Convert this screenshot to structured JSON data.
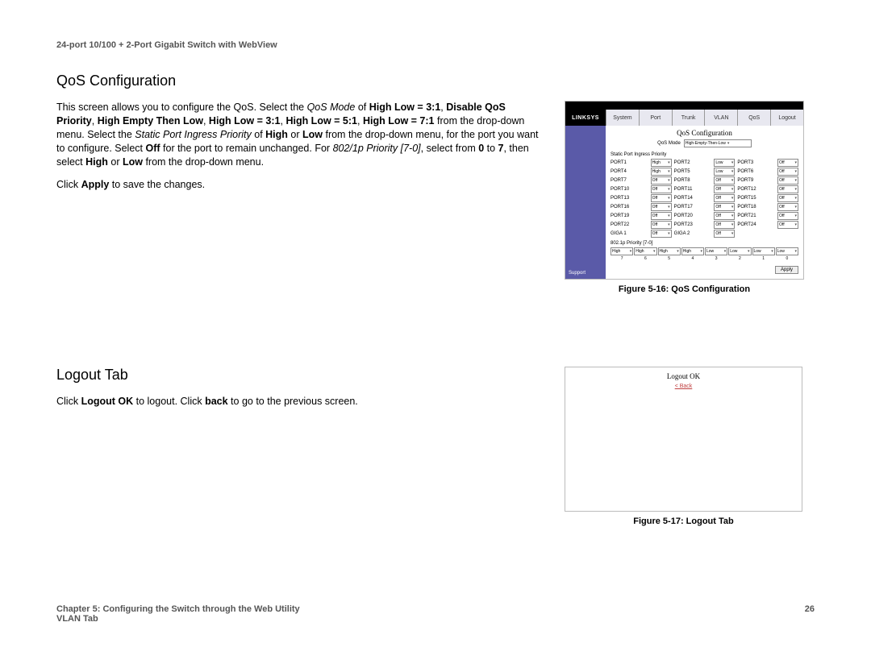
{
  "doc_header": "24-port 10/100 + 2-Port Gigabit Switch with WebView",
  "section1_title": "QoS Configuration",
  "para1_a": "This screen allows you to configure the QoS. Select the ",
  "para1_i1": "QoS Mode",
  "para1_b": " of ",
  "para1_b1": "High Low = 3:1",
  "para1_c": ", ",
  "para1_b2": "Disable QoS Priority",
  "para1_d": ", ",
  "para1_b3": "High Empty Then Low",
  "para1_e": ", ",
  "para1_b4": "High Low = 3:1",
  "para1_f": ", ",
  "para1_b5": "High Low = 5:1",
  "para1_g": ", ",
  "para1_b6": "High Low = 7:1",
  "para1_h": " from the drop-down menu. Select the ",
  "para1_i2": "Static Port Ingress Priority",
  "para1_i": " of ",
  "para1_b7": "High",
  "para1_j": " or ",
  "para1_b8": "Low",
  "para1_k": " from the drop-down menu, for the port you want to configure. Select ",
  "para1_b9": "Off",
  "para1_l": " for the port to remain unchanged. For ",
  "para1_i3": "802/1p Priority [7-0]",
  "para1_m": ", select from ",
  "para1_b10": "0",
  "para1_n": " to ",
  "para1_b11": "7",
  "para1_o": ", then select ",
  "para1_b12": "High",
  "para1_p": " or ",
  "para1_b13": "Low",
  "para1_q": " from the drop-down menu.",
  "para2_a": "Click ",
  "para2_b1": "Apply",
  "para2_b": " to save the changes.",
  "section2_title": "Logout Tab",
  "para3_a": "Click ",
  "para3_b1": "Logout OK",
  "para3_b": " to logout. Click ",
  "para3_b2": "back",
  "para3_c": " to go to the previous screen.",
  "fig516_caption": "Figure 5-16: QoS Configuration",
  "fig517_caption": "Figure 5-17: Logout Tab",
  "fig516": {
    "logo": "LINKSYS",
    "tabs": [
      "System",
      "Port",
      "Trunk",
      "VLAN",
      "QoS",
      "Logout"
    ],
    "title": "QoS Configuration",
    "qos_mode_label": "QoS Mode",
    "qos_mode_value": "High-Empty-Then-Low",
    "section_ports": "Static Port Ingress Priority",
    "ports": [
      {
        "n": "PORT1",
        "v": "High"
      },
      {
        "n": "PORT2",
        "v": "Low"
      },
      {
        "n": "PORT3",
        "v": "Off"
      },
      {
        "n": "PORT4",
        "v": "High"
      },
      {
        "n": "PORT5",
        "v": "Low"
      },
      {
        "n": "PORT6",
        "v": "Off"
      },
      {
        "n": "PORT7",
        "v": "Off"
      },
      {
        "n": "PORT8",
        "v": "Off"
      },
      {
        "n": "PORT9",
        "v": "Off"
      },
      {
        "n": "PORT10",
        "v": "Off"
      },
      {
        "n": "PORT11",
        "v": "Off"
      },
      {
        "n": "PORT12",
        "v": "Off"
      },
      {
        "n": "PORT13",
        "v": "Off"
      },
      {
        "n": "PORT14",
        "v": "Off"
      },
      {
        "n": "PORT15",
        "v": "Off"
      },
      {
        "n": "PORT16",
        "v": "Off"
      },
      {
        "n": "PORT17",
        "v": "Off"
      },
      {
        "n": "PORT18",
        "v": "Off"
      },
      {
        "n": "PORT19",
        "v": "Off"
      },
      {
        "n": "PORT20",
        "v": "Off"
      },
      {
        "n": "PORT21",
        "v": "Off"
      },
      {
        "n": "PORT22",
        "v": "Off"
      },
      {
        "n": "PORT23",
        "v": "Off"
      },
      {
        "n": "PORT24",
        "v": "Off"
      },
      {
        "n": "GIGA 1",
        "v": "Off"
      },
      {
        "n": "GIGA 2",
        "v": "Off"
      }
    ],
    "section_802": "802.1p Priority [7-0]",
    "p802": [
      "High",
      "High",
      "High",
      "High",
      "Low",
      "Low",
      "Low",
      "Low"
    ],
    "p802nums": [
      "7",
      "6",
      "5",
      "4",
      "3",
      "2",
      "1",
      "0"
    ],
    "apply": "Apply",
    "support": "Support"
  },
  "fig517": {
    "ok": "Logout OK",
    "back": "< Back"
  },
  "footer_left_line1": "Chapter 5: Configuring the Switch through the Web Utility",
  "footer_left_line2": "VLAN Tab",
  "footer_right": "26"
}
